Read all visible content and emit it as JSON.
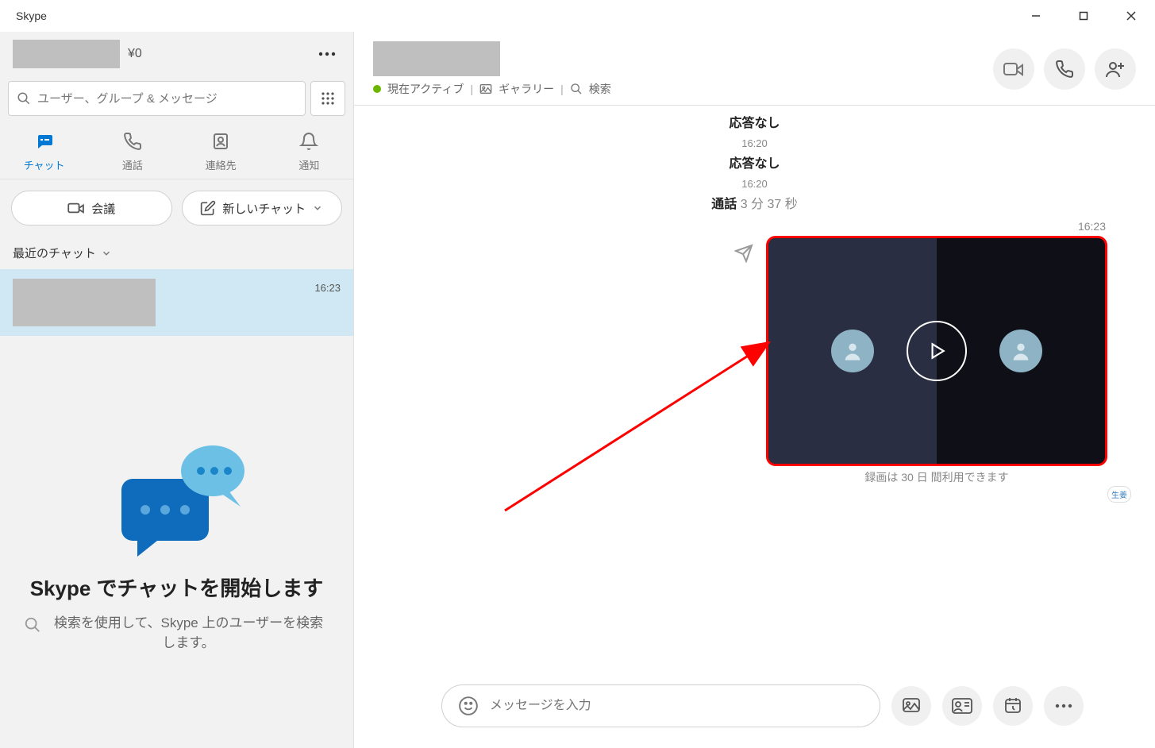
{
  "window": {
    "title": "Skype"
  },
  "sidebar": {
    "credit": "¥0",
    "search_placeholder": "ユーザー、グループ & メッセージ",
    "tabs": {
      "chat": "チャット",
      "calls": "通話",
      "contacts": "連絡先",
      "notifications": "通知"
    },
    "meeting_label": "会議",
    "new_chat_label": "新しいチャット",
    "recent_header": "最近のチャット",
    "chat_item": {
      "time": "16:23"
    },
    "promo": {
      "title_prefix": "Skype",
      "title_rest": " でチャットを開始します",
      "sub": "検索を使用して、Skype 上のユーザーを検索します。"
    }
  },
  "chat": {
    "status": "現在アクティブ",
    "gallery": "ギャラリー",
    "search": "検索",
    "messages": [
      {
        "type": "noanswer",
        "time": "",
        "text": "応答なし"
      },
      {
        "type": "noanswer",
        "time": "16:20",
        "text": "応答なし"
      },
      {
        "type": "call",
        "time": "16:20",
        "text": "通話",
        "duration": "3 分 37 秒"
      }
    ],
    "recording": {
      "time": "16:23",
      "caption": "録画は 30 日 間利用できます",
      "reaction": "生姜"
    },
    "composer_placeholder": "メッセージを入力"
  }
}
